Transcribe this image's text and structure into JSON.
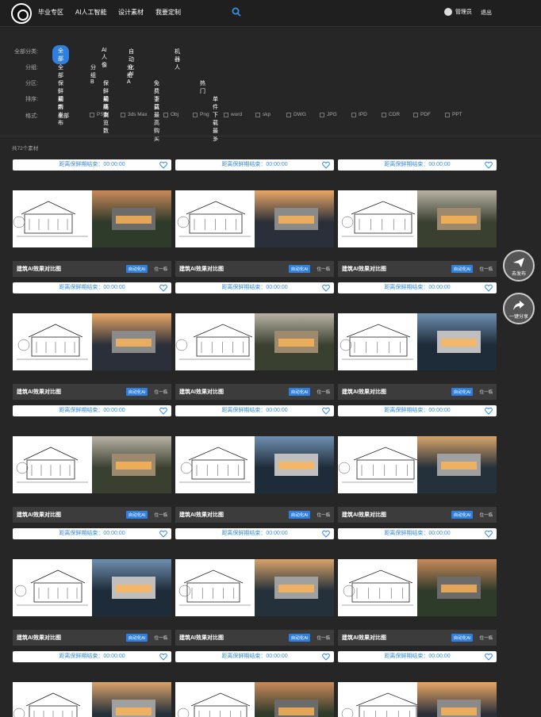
{
  "header": {
    "nav": [
      "毕业专区",
      "AI人工智能",
      "设计素材",
      "我要定制"
    ],
    "user": "管理员",
    "logout": "退出"
  },
  "filters": {
    "category": {
      "label": "全部分类:",
      "options": [
        "全部",
        "AI人像",
        "自动化AI",
        "机器人"
      ],
      "active": 0
    },
    "group": {
      "label": "分组:",
      "options": [
        "全部",
        "分组B",
        "分组A"
      ]
    },
    "zone": {
      "label": "分区:",
      "options": [
        "保鲜期内",
        "保鲜期结束",
        "免费下载",
        "热门"
      ]
    },
    "sort": {
      "label": "排序:",
      "options": [
        "最新发布",
        "最高浏览数",
        "会员最高购买",
        "单件下载最多"
      ]
    },
    "format": {
      "label": "格式:",
      "all": "全部",
      "options": [
        "PSD",
        "3ds Max",
        "Obj",
        "Png",
        "word",
        "skp",
        "DWG",
        "JPG",
        "IPD",
        "CDR",
        "PDF",
        "PPT"
      ]
    }
  },
  "count": "共72个素材",
  "card": {
    "timer": "距离保鲜期结束：00:00:00",
    "title": "建筑AI效果对比图",
    "tag": "自动化AI",
    "tail": "住一临"
  },
  "side": {
    "publish": "去发布",
    "share": "一键分享"
  },
  "colors": {
    "accent": "#2f7fe0",
    "bg": "#262626"
  }
}
